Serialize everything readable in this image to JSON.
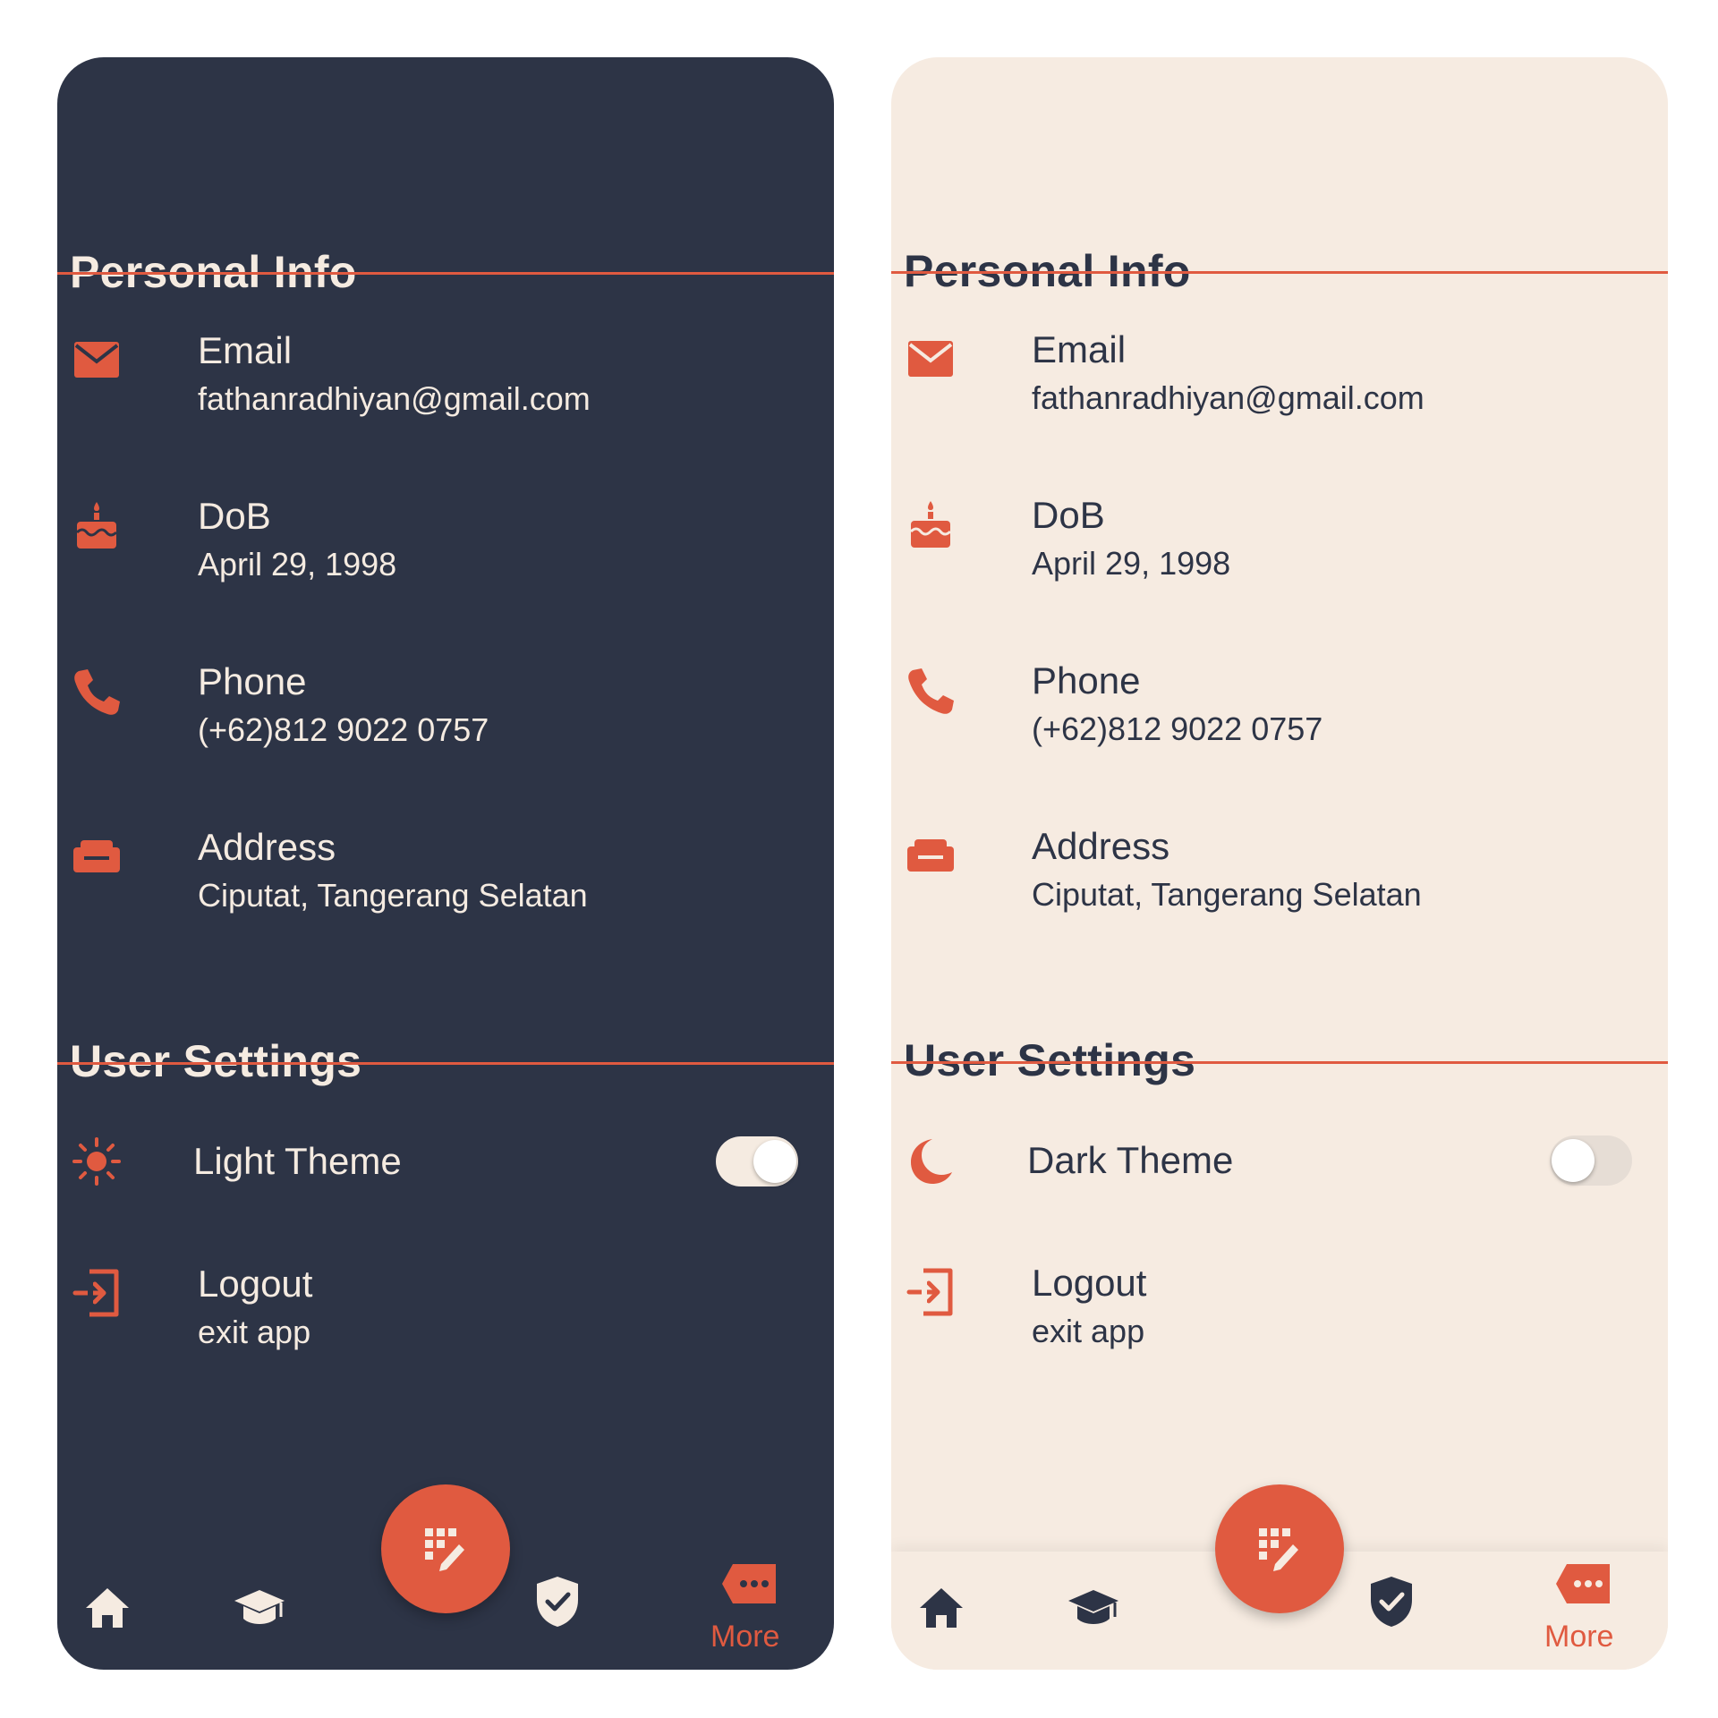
{
  "colors": {
    "accent": "#e05a40",
    "dark_bg": "#2d3446",
    "light_bg": "#f6ebe1",
    "dark_text": "#f5ebe1",
    "light_text": "#2d3446"
  },
  "dark": {
    "personal_title": "Personal Info",
    "email": {
      "label": "Email",
      "value": "fathanradhiyan@gmail.com",
      "icon": "envelope-icon"
    },
    "dob": {
      "label": "DoB",
      "value": "April 29, 1998",
      "icon": "cake-icon"
    },
    "phone": {
      "label": "Phone",
      "value": "(+62)812 9022 0757",
      "icon": "phone-icon"
    },
    "address": {
      "label": "Address",
      "value": "Ciputat, Tangerang Selatan",
      "icon": "couch-icon"
    },
    "settings_title": "User Settings",
    "theme": {
      "label": "Light Theme",
      "icon": "sun-icon",
      "enabled": true
    },
    "logout": {
      "label": "Logout",
      "value": "exit app",
      "icon": "logout-icon"
    },
    "nav": {
      "more_label": "More",
      "active": "more"
    }
  },
  "light": {
    "personal_title": "Personal Info",
    "email": {
      "label": "Email",
      "value": "fathanradhiyan@gmail.com",
      "icon": "envelope-icon"
    },
    "dob": {
      "label": "DoB",
      "value": "April 29, 1998",
      "icon": "cake-icon"
    },
    "phone": {
      "label": "Phone",
      "value": "(+62)812 9022 0757",
      "icon": "phone-icon"
    },
    "address": {
      "label": "Address",
      "value": "Ciputat, Tangerang Selatan",
      "icon": "couch-icon"
    },
    "settings_title": "User Settings",
    "theme": {
      "label": "Dark Theme",
      "icon": "moon-icon",
      "enabled": false
    },
    "logout": {
      "label": "Logout",
      "value": "exit app",
      "icon": "logout-icon"
    },
    "nav": {
      "more_label": "More",
      "active": "more"
    }
  }
}
